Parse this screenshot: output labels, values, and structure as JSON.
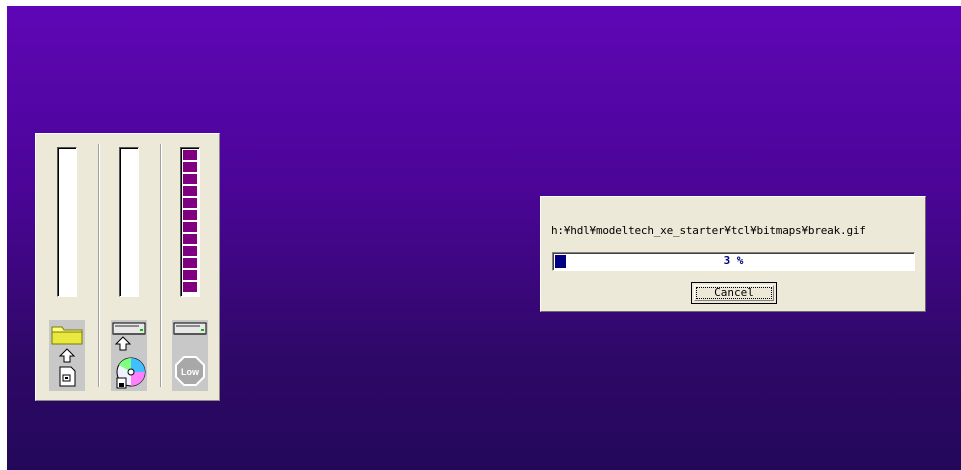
{
  "meter_panel": {
    "gauges": [
      {
        "name": "gauge-1",
        "level": 0
      },
      {
        "name": "gauge-2",
        "level": 0
      },
      {
        "name": "gauge-3",
        "level": 1.0
      }
    ],
    "low_label": "Low",
    "icons": [
      "folder-icon",
      "up-arrow-icon",
      "document-icon",
      "drive-icon",
      "up-arrow-icon",
      "cd-icon",
      "drive-icon",
      "stop-sign-icon"
    ]
  },
  "progress_dialog": {
    "file_path": "h:¥hdl¥modeltech_xe_starter¥tcl¥bitmaps¥break.gif",
    "progress_percent": 3,
    "progress_text": "3 %",
    "cancel_label": "Cancel"
  },
  "colors": {
    "desktop_top": "#5f06b6",
    "desktop_bottom": "#23085a",
    "gauge_fill": "#800080",
    "progress_fill": "#000080",
    "panel_bg": "#ece9d8"
  }
}
